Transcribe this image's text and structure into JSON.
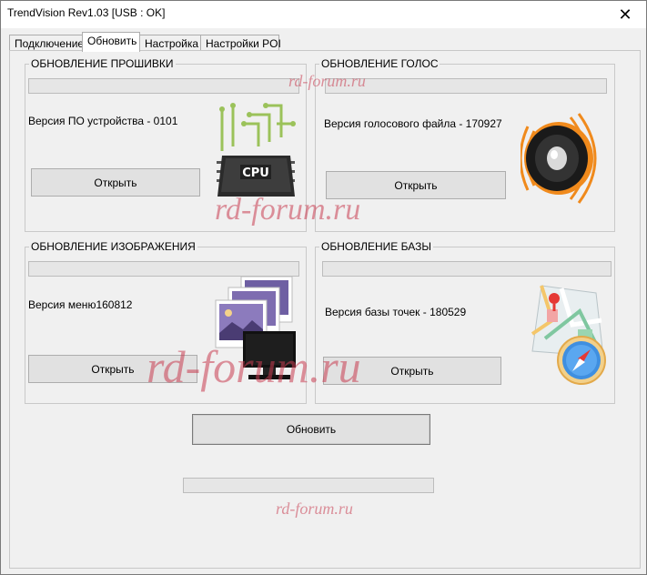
{
  "window": {
    "title": "TrendVision Rev1.03 [USB : OK]",
    "close_glyph": "✕"
  },
  "tabs": [
    {
      "label": "Подключение",
      "active": false
    },
    {
      "label": "Обновить",
      "active": true
    },
    {
      "label": "Настройка",
      "active": false
    },
    {
      "label": "Настройки POI",
      "active": false
    }
  ],
  "groups": {
    "firmware": {
      "title": "ОБНОВЛЕНИЕ ПРОШИВКИ",
      "version": "Версия ПО устройства - 0101",
      "button": "Открыть",
      "icon": "cpu-chip-icon",
      "progress": 0
    },
    "voice": {
      "title": "ОБНОВЛЕНИЕ ГОЛОС",
      "version": "Версия голосового файла - 170927",
      "button": "Открыть",
      "icon": "speaker-icon",
      "progress": 0
    },
    "image": {
      "title": "ОБНОВЛЕНИЕ ИЗОБРАЖЕНИЯ",
      "version": "Версия меню160812",
      "button": "Открыть",
      "icon": "images-monitor-icon",
      "progress": 0
    },
    "database": {
      "title": "ОБНОВЛЕНИЕ БАЗЫ",
      "version": "Версия базы точек - 180529",
      "button": "Открыть",
      "icon": "map-compass-icon",
      "progress": 0
    }
  },
  "main_button": "Обновить",
  "main_progress": 0,
  "watermarks": [
    "rd-forum.ru",
    "rd-forum.ru",
    "rd-forum.ru",
    "rd-forum.ru"
  ],
  "colors": {
    "window_bg": "#f0f0f0",
    "button_bg": "#e1e1e1",
    "watermark": "#c83c50"
  }
}
